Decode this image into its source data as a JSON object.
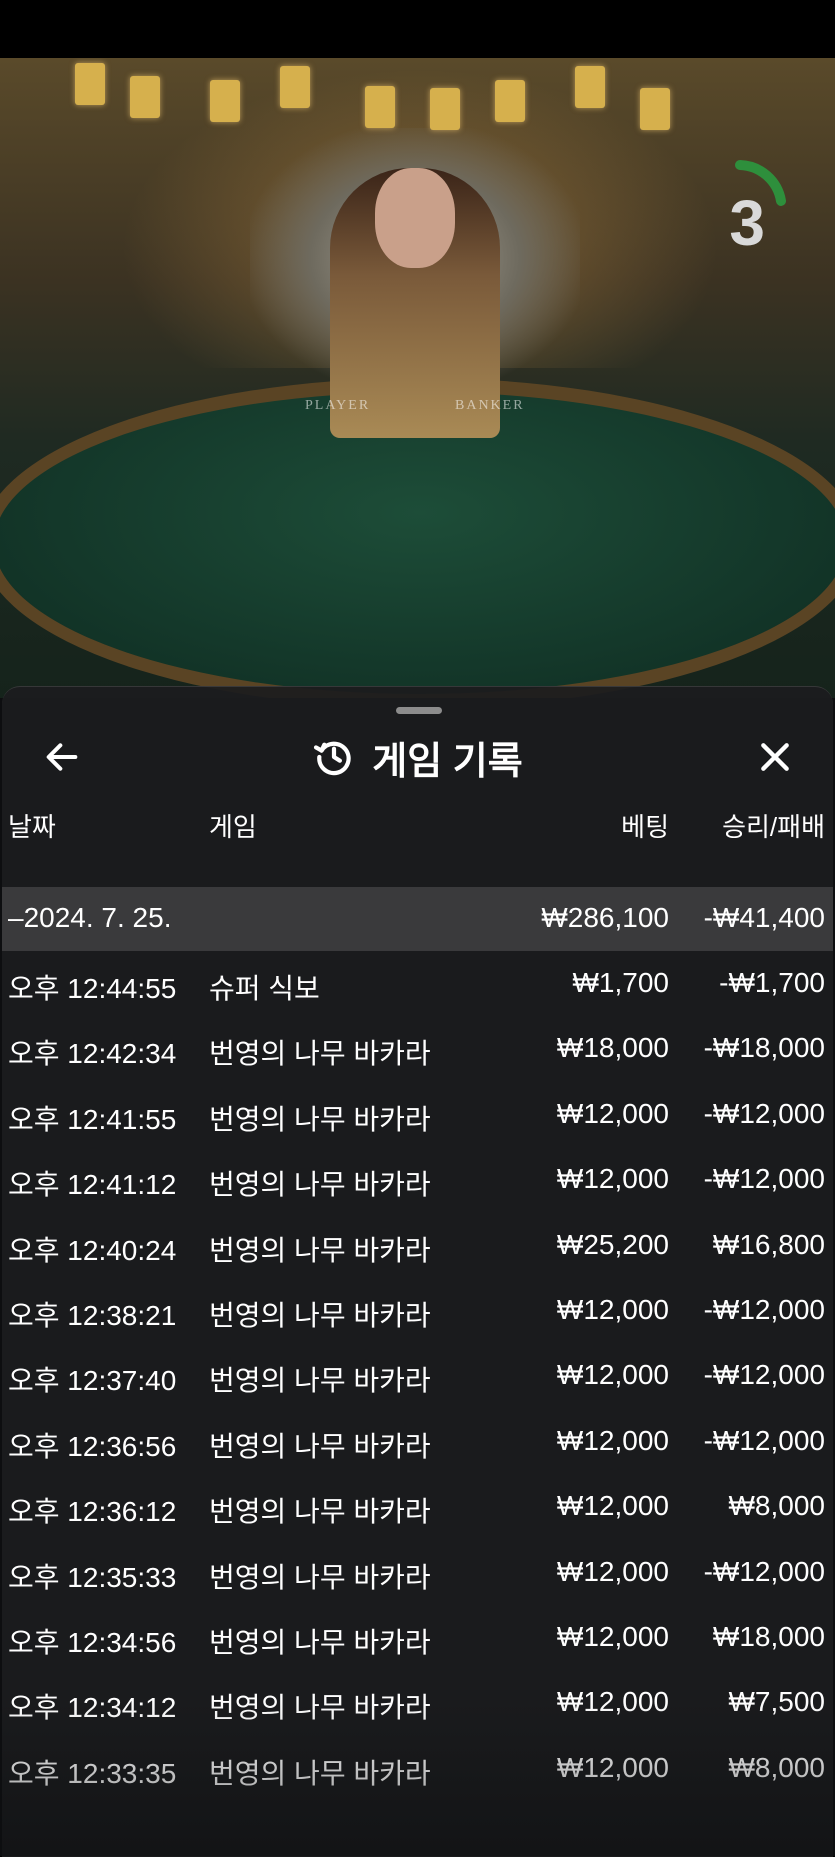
{
  "video": {
    "countdown": "3",
    "table_text_left": "PLAYER",
    "table_text_right": "BANKER"
  },
  "history": {
    "title": "게임 기록",
    "icons": {
      "back": "back-arrow-icon",
      "history": "history-icon",
      "close": "close-icon"
    },
    "columns": {
      "date": "날짜",
      "game": "게임",
      "bet": "베팅",
      "result": "승리/패배"
    },
    "group": {
      "date": "–2024. 7. 25.",
      "bet_total": "₩286,100",
      "result_total": "-₩41,400"
    },
    "rows": [
      {
        "time": "오후 12:44:55",
        "game": "슈퍼 식보",
        "bet": "₩1,700",
        "result": "-₩1,700"
      },
      {
        "time": "오후 12:42:34",
        "game": "번영의 나무 바카라",
        "bet": "₩18,000",
        "result": "-₩18,000"
      },
      {
        "time": "오후 12:41:55",
        "game": "번영의 나무 바카라",
        "bet": "₩12,000",
        "result": "-₩12,000"
      },
      {
        "time": "오후 12:41:12",
        "game": "번영의 나무 바카라",
        "bet": "₩12,000",
        "result": "-₩12,000"
      },
      {
        "time": "오후 12:40:24",
        "game": "번영의 나무 바카라",
        "bet": "₩25,200",
        "result": "₩16,800"
      },
      {
        "time": "오후 12:38:21",
        "game": "번영의 나무 바카라",
        "bet": "₩12,000",
        "result": "-₩12,000"
      },
      {
        "time": "오후 12:37:40",
        "game": "번영의 나무 바카라",
        "bet": "₩12,000",
        "result": "-₩12,000"
      },
      {
        "time": "오후 12:36:56",
        "game": "번영의 나무 바카라",
        "bet": "₩12,000",
        "result": "-₩12,000"
      },
      {
        "time": "오후 12:36:12",
        "game": "번영의 나무 바카라",
        "bet": "₩12,000",
        "result": "₩8,000"
      },
      {
        "time": "오후 12:35:33",
        "game": "번영의 나무 바카라",
        "bet": "₩12,000",
        "result": "-₩12,000"
      },
      {
        "time": "오후 12:34:56",
        "game": "번영의 나무 바카라",
        "bet": "₩12,000",
        "result": "₩18,000"
      },
      {
        "time": "오후 12:34:12",
        "game": "번영의 나무 바카라",
        "bet": "₩12,000",
        "result": "₩7,500"
      },
      {
        "time": "오후 12:33:35",
        "game": "번영의 나무 바카라",
        "bet": "₩12,000",
        "result": "₩8,000"
      }
    ]
  }
}
